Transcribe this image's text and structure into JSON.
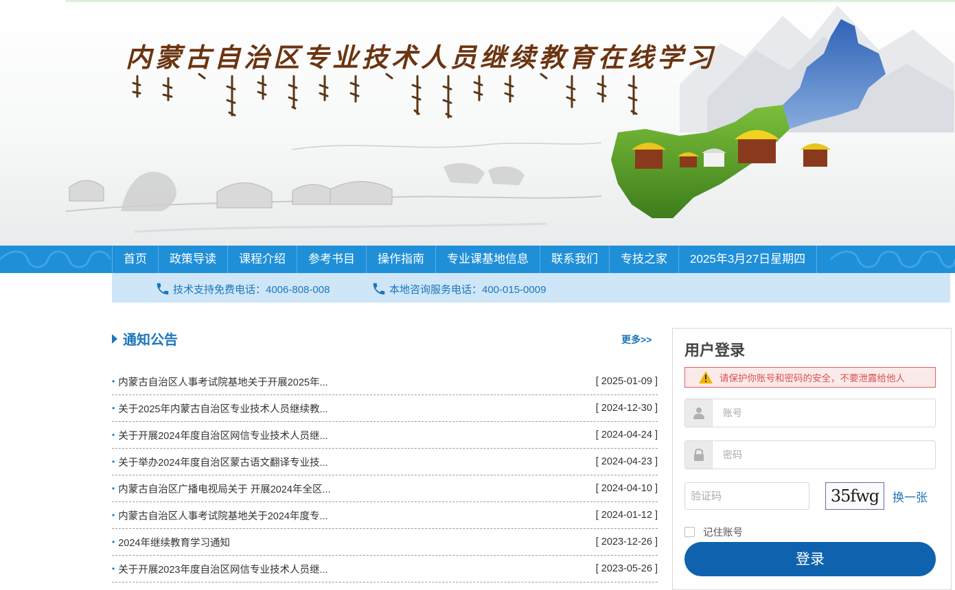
{
  "banner": {
    "title": "内蒙古自治区专业技术人员继续教育在线学习",
    "logo_note": "Mongolian script subtitle (decorative)"
  },
  "nav": {
    "items": [
      "首页",
      "政策导读",
      "课程介绍",
      "参考书目",
      "操作指南",
      "专业课基地信息",
      "联系我们",
      "专技之家"
    ],
    "date": "2025年3月27日星期四"
  },
  "hotline": {
    "tech_support": "技术支持免费电话：4006-808-008",
    "local_service": "本地咨询服务电话：400-015-0009"
  },
  "notices": {
    "title": "通知公告",
    "more": "更多>>",
    "items": [
      {
        "text": "内蒙古自治区人事考试院基地关于开展2025年...",
        "date": "[ 2025-01-09 ]"
      },
      {
        "text": "关于2025年内蒙古自治区专业技术人员继续教...",
        "date": "[ 2024-12-30 ]"
      },
      {
        "text": "关于开展2024年度自治区网信专业技术人员继...",
        "date": "[ 2024-04-24 ]"
      },
      {
        "text": "关于举办2024年度自治区蒙古语文翻译专业技...",
        "date": "[ 2024-04-23 ]"
      },
      {
        "text": "内蒙古自治区广播电视局关于 开展2024年全区...",
        "date": "[ 2024-04-10 ]"
      },
      {
        "text": "内蒙古自治区人事考试院基地关于2024年度专...",
        "date": "[ 2024-01-12 ]"
      },
      {
        "text": "2024年继续教育学习通知",
        "date": "[ 2023-12-26 ]"
      },
      {
        "text": "关于开展2023年度自治区网信专业技术人员继...",
        "date": "[ 2023-05-26 ]"
      }
    ]
  },
  "login": {
    "title": "用户登录",
    "warning": "请保护你账号和密码的安全，不要泄露给他人",
    "account_placeholder": "账号",
    "password_placeholder": "密码",
    "captcha_placeholder": "验证码",
    "captcha_text": "35fwg",
    "refresh": "换一张",
    "remember": "记住账号",
    "submit": "登录"
  },
  "colors": {
    "brand_blue": "#1a75bb",
    "nav_blue": "#1f8fd8",
    "login_button": "#0f62ad",
    "hotline_bg": "#cfe6f8"
  }
}
